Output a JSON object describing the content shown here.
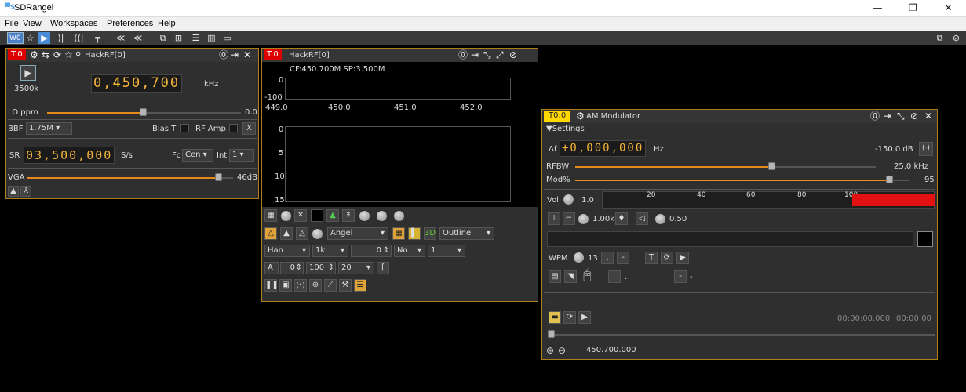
{
  "app": {
    "title": "SDRangel"
  },
  "menu": [
    "File",
    "View",
    "Workspaces",
    "Preferences",
    "Help"
  ],
  "toolbar": {
    "workspace": "W0"
  },
  "device_panel": {
    "tag": "T:0",
    "name": "HackRF[0]",
    "frequency": "0,450,700",
    "freq_unit": "kHz",
    "sample_rate_label": "3500k",
    "lo_label": "LO ppm",
    "lo_value": "0.0",
    "bbf_label": "BBF",
    "bbf_value": "1.75M",
    "bias_label": "Bias T",
    "rfamp_label": "RF Amp",
    "x_label": "X",
    "sr_label": "SR",
    "sr_value": "03,500,000",
    "sr_unit": "S/s",
    "fc_label": "Fc",
    "fc_value": "Cen",
    "int_label": "Int",
    "int_value": "1",
    "vga_label": "VGA",
    "vga_value": "46dB"
  },
  "spectrum_panel": {
    "tag": "T:0",
    "name": "HackRF[0]",
    "cf_text": "CF:450.700M SP:3.500M",
    "y_top_0": "0",
    "y_top_100": "-100",
    "x_ticks": [
      "449.0",
      "450.0",
      "451.0",
      "452.0"
    ],
    "wf_ticks": [
      "0",
      "5",
      "10",
      "15"
    ],
    "palette": "Angel",
    "mode": "Outline",
    "window": "Han",
    "fft": "1k",
    "overlap": "0",
    "averaging": "No",
    "avg_n": "1",
    "a_label": "A",
    "a_val": "0",
    "ref_val": "100",
    "range_val": "20"
  },
  "am_mod": {
    "tag": "T0:0",
    "name": "AM Modulator",
    "settings": "Settings",
    "df_label": "Δf",
    "df_value": "+0,000,000",
    "df_unit": "Hz",
    "power": "-150.0 dB",
    "rfbw_label": "RFBW",
    "rfbw_value": "25.0 kHz",
    "mod_label": "Mod%",
    "mod_value": "95",
    "vol_label": "Vol",
    "vol_value": "1.0",
    "vu_ticks": [
      "20",
      "40",
      "60",
      "80",
      "100"
    ],
    "tone_value": "1.00k",
    "gain_value": "0.50",
    "wpm_label": "WPM",
    "wpm_value": "13",
    "dot": ".",
    "dash": "-",
    "t_label": "T",
    "ellipsis": "...",
    "time1": "00:00:00.000",
    "time2": "00:00:00",
    "frequency_readout": "450.700.000"
  }
}
